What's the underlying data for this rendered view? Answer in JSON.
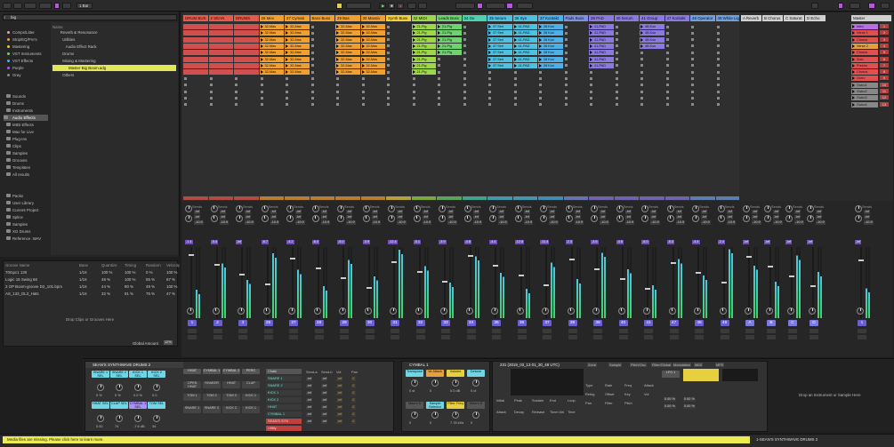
{
  "topbar": {
    "bar_select": "1 Bar",
    "tempo": "",
    "sig": "",
    "pos": "",
    "loop_start": "",
    "zoom": ""
  },
  "browser": {
    "search": "big",
    "categories": [
      "Comps/Litter",
      "Strip/EQ/Pre's",
      "Mastering",
      "VST Instruments",
      "VST Effects",
      "Purple",
      "Gray"
    ],
    "category_colors": [
      "#e6a6a6",
      "#e6a040",
      "#e6d040",
      "#6fd16f",
      "#40b8e6",
      "#a060e0",
      "#888888"
    ],
    "places": [
      "Sounds",
      "Drums",
      "Instruments",
      "Audio Effects",
      "MIDI Effects",
      "Max for Live",
      "Plug-Ins",
      "Clips",
      "Samples",
      "Grooves",
      "Templates",
      "All results"
    ],
    "places_selected": "Audio Effects",
    "libs": [
      "Packs",
      "User Library",
      "Current Project",
      "Splice",
      "Samples",
      "XO Drums",
      "Reference .WAV"
    ],
    "list_header": "Name",
    "files": [
      "Reverb & Resonance",
      "Utilities",
      "Audio Effect Rack",
      "Drums",
      "Mixing & Mastering",
      "Master Big Boom.adg",
      "Others"
    ],
    "selected_file": "Master Big Boom.adg"
  },
  "groove": {
    "headers": [
      "Groove Name",
      "Base",
      "Quantize",
      "Timing",
      "Random",
      "Velocity"
    ],
    "rows": [
      [
        "70mpc1 130",
        "1/16",
        "100 %",
        "100 %",
        "0 %",
        "100 %"
      ],
      [
        "Logic 16 Swing 66",
        "1/16",
        "48 %",
        "100 %",
        "55 %",
        "67 %"
      ],
      [
        "2 OP Boom-groove D2_101.bpm",
        "1/16",
        "44 %",
        "80 %",
        "49 %",
        "100 %"
      ],
      [
        "AS_133_DL3_Hats",
        "1/16",
        "32 %",
        "91 %",
        "76 %",
        "47 %"
      ]
    ],
    "drop_hint": "Drop Clips or Grooves Here",
    "global_label": "Global Amount",
    "global_value": "12%"
  },
  "tracks": [
    {
      "name": "DRUM BUS",
      "color": "#e55a4a",
      "num": "1",
      "vol": "-1.4"
    },
    {
      "name": "2 SEAN",
      "color": "#e55a4a",
      "num": "2",
      "vol": "-5.4"
    },
    {
      "name": "DRUMS",
      "color": "#e55a4a",
      "num": "3",
      "vol": "-inf"
    },
    {
      "name": "26 Mev",
      "color": "#f0a030",
      "num": "26",
      "vol": "-6.7"
    },
    {
      "name": "27 Cymati",
      "color": "#f0a030",
      "num": "27",
      "vol": "-4.2"
    },
    {
      "name": "Bass Buss",
      "color": "#f0a030",
      "num": "28",
      "vol": "-6.0"
    },
    {
      "name": "29 Bas",
      "color": "#f0a030",
      "num": "29",
      "vol": "-5.0"
    },
    {
      "name": "30 Massiv",
      "color": "#f0a030",
      "num": "30",
      "vol": "-3.9"
    },
    {
      "name": "Synth Buss",
      "color": "#f0d040",
      "num": "31",
      "vol": "-12.4"
    },
    {
      "name": "32 MIDI",
      "color": "#9dd84a",
      "num": "32",
      "vol": "-5.1"
    },
    {
      "name": "Leads Buss",
      "color": "#6fd16f",
      "num": "33",
      "vol": "-3.9"
    },
    {
      "name": "34 Ge",
      "color": "#4fd0b0",
      "num": "34",
      "vol": "-4.8"
    },
    {
      "name": "35 Serum",
      "color": "#4fc0e0",
      "num": "35",
      "vol": "-4.4"
    },
    {
      "name": "36 Syn",
      "color": "#4fc0e0",
      "num": "36",
      "vol": "-12.8"
    },
    {
      "name": "37 Kontakt",
      "color": "#4fb0e8",
      "num": "37",
      "vol": "-11.4"
    },
    {
      "name": "Pads Buss",
      "color": "#8090e0",
      "num": "38",
      "vol": "-2.3"
    },
    {
      "name": "39 PAD",
      "color": "#8a7ae0",
      "num": "39",
      "vol": "-3.5"
    },
    {
      "name": "40 Serum",
      "color": "#8a7ae0",
      "num": "40",
      "vol": "-4.6"
    },
    {
      "name": "41 Group",
      "color": "#8a7ae0",
      "num": "41",
      "vol": "-6.0"
    },
    {
      "name": "47 Kontakt",
      "color": "#8a7ae0",
      "num": "47",
      "vol": "-5.3"
    },
    {
      "name": "48 Operator",
      "color": "#6fa0e0",
      "num": "48",
      "vol": "-4.4"
    },
    {
      "name": "49 White Light",
      "color": "#6fa0e0",
      "num": "49",
      "vol": "-2.4"
    }
  ],
  "clip_labels": {
    "a": "32-Mas",
    "b": "21-Pig",
    "c": "41-PAD",
    "d": "37 Seri",
    "e": "48-Kon",
    "f": "26 Kon"
  },
  "returns": [
    {
      "name": "A Reverb",
      "color": "#d0d0d0",
      "num": "A"
    },
    {
      "name": "B Chorus",
      "color": "#d0d0d0",
      "num": "B"
    },
    {
      "name": "C Saturat",
      "color": "#d0d0d0",
      "num": "C"
    },
    {
      "name": "D Echo",
      "color": "#d0d0d0",
      "num": "D"
    }
  ],
  "master": {
    "name": "Master",
    "num": "1",
    "scenes": [
      "Intro",
      "Verse 1",
      "Chorus",
      "Verse 2",
      "Chorus",
      "Solo",
      "Precho",
      "Chorus",
      "Outro",
      "Outro1",
      "Outro2",
      "Outro3",
      "Outro4"
    ],
    "scene_colors": [
      "#b870e0",
      "#e05050",
      "#e05050",
      "#e0a040",
      "#e05050",
      "#e05050",
      "#e05050",
      "#e05050",
      "#e05050",
      "#888",
      "#888",
      "#888",
      "#888"
    ]
  },
  "mixer": {
    "sends_label": "Sends",
    "send_vals": [
      "-inf",
      "-inf",
      "-10.9"
    ],
    "post": "Post"
  },
  "drum_rack": {
    "title": "SEAN'S SYNTHWAVE DRUMS 2",
    "pads": [
      [
        "SNARE 1\nSEL",
        "SNARE 2\nSEL",
        "KICK 1\nSEL",
        "KICK 2\nSEL"
      ],
      [
        "HHAT\nSEL",
        "CLAP\nSEL",
        "CYMBAL\n1 SEL",
        "TOM SEL"
      ]
    ],
    "pad_colors": [
      [
        "#6fd6e6",
        "#6fd6e6",
        "#6fd6e6",
        "#6fd6e6"
      ],
      [
        "#6fd6e6",
        "#6fd6e6",
        "#a890ff",
        "#6fd6e6"
      ]
    ],
    "knob_vals": [
      "0 %",
      "0 %",
      "0.0 %",
      "0.0",
      "0.00",
      "74",
      "-7.6 dB",
      "34"
    ],
    "chain_tabs": [
      "HHAT",
      "CYMBAL 1",
      "CYMBAL 2",
      "PERC"
    ],
    "chain_pads": [
      "OPEN HHAT",
      "SHAKER",
      "HHAT",
      "CLAP",
      "TOM 1",
      "TOM 2",
      "TOM 3",
      "KICK 1",
      "SNARE 1",
      "SNARE 2",
      "KICK 2",
      "KICK 1"
    ],
    "chain_list": [
      "Chain",
      "SNARE 1",
      "SNARE 2",
      "KICK 1",
      "KICK 2",
      "HHAT",
      "CYMBAL 1",
      "SEAN'S SYN",
      "Utility"
    ],
    "chain_cols": [
      "Send-a",
      "Send-b",
      "Vol",
      "Pan"
    ]
  },
  "cymbal": {
    "title": "CYMBAL 1",
    "knobs": [
      "Transpose",
      "Ve Attack",
      "Volume",
      "Detune",
      "Macro 5",
      "Sample Selector",
      "Filter Freq",
      "Macro 8"
    ],
    "vals": [
      "0 st",
      "0",
      "0.0 dB",
      "0 ct",
      "0",
      "0",
      "7.78 kHz",
      "0"
    ]
  },
  "sampler": {
    "title": "231 (2019_03_13 01_30_48 UTC)",
    "tabs": [
      "Zone",
      "Sample",
      "Pitch/Osc",
      "Filter/Global",
      "Modulation",
      "MIDI",
      "MPE"
    ],
    "env": [
      "Initial",
      "Peak",
      "Sustain",
      "End",
      "Loop"
    ],
    "env2": [
      "Attack",
      "Decay",
      "Release",
      "Time<Vel",
      "Time"
    ],
    "lfo": [
      "Type",
      "Rate",
      "Freq",
      "Attack",
      "Retrig",
      "Offset",
      "Key",
      "Vol",
      "Pan",
      "Filter",
      "Pitch"
    ],
    "lfo_vals": [
      "0.00 %",
      "0.00 %",
      "0.00 %",
      "0.00 %"
    ],
    "lfo_name": "LFO 1"
  },
  "drop_hint": "Drop an Instrument or Sample Here",
  "status": {
    "message": "Media files are missing. Please click here to learn more.",
    "track": "1-SEAN'S SYNTHWAVE DRUMS 2"
  }
}
